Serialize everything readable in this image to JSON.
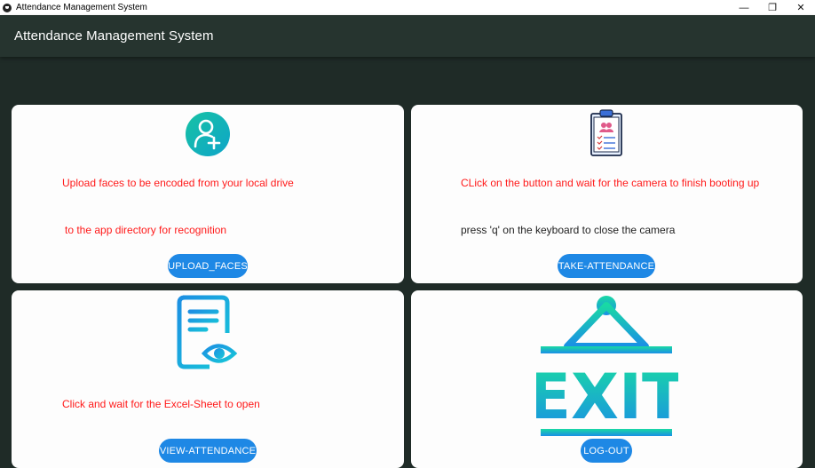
{
  "window": {
    "title": "Attendance Management System",
    "controls": [
      "—",
      "❐",
      "✕"
    ]
  },
  "appbar": {
    "title": "Attendance Management System"
  },
  "cards": {
    "upload": {
      "icon": "add-user-icon",
      "line1": "Upload faces to be encoded from your local drive",
      "line2": "to the app directory for recognition",
      "button": "UPLOAD_FACES"
    },
    "take": {
      "icon": "clipboard-attendance-icon",
      "line1": "CLick on the button and wait for the camera to finish booting up",
      "line2": "press 'q' on the keyboard to close the camera",
      "button": "TAKE-ATTENDANCE"
    },
    "view": {
      "icon": "document-view-icon",
      "line1": "Click and wait for the Excel-Sheet to open",
      "button": "VIEW-ATTENDANCE"
    },
    "exit": {
      "icon": "exit-sign-icon",
      "sign_text": "EXIT",
      "button": "LOG-OUT"
    }
  },
  "colors": {
    "background": "#1f2b27",
    "appbar": "#26342f",
    "accent": "#1e88e5",
    "warning_text": "#ff1a1a",
    "icon_teal": "#16c4b4",
    "icon_blue": "#1f9ae0"
  }
}
